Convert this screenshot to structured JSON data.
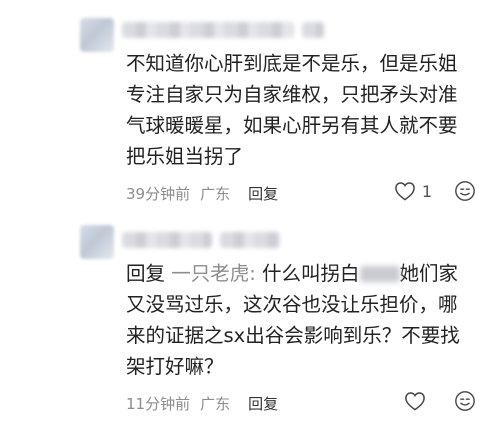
{
  "comments": [
    {
      "text": "不知道你心肝到底是不是乐，但是乐姐专注自家只为自家维权，只把矛头对准 气球暖暖星，如果心肝另有其人就不要把乐姐当拐了",
      "time": "39分钟前",
      "location": "广东",
      "reply_label": "回复",
      "like_count": "1"
    },
    {
      "reply_prefix": "回复",
      "reply_target": "一只老虎:",
      "text_before": " 什么叫拐白",
      "text_after": "她们家又没骂过乐，这次谷也没让乐担价，哪来的证据之sx出谷会影响到乐？不要找架打好嘛？",
      "time": "11分钟前",
      "location": "广东",
      "reply_label": "回复",
      "like_count": ""
    }
  ],
  "icons": {
    "like": "heart-outline-icon",
    "emoji": "smiley-icon"
  }
}
